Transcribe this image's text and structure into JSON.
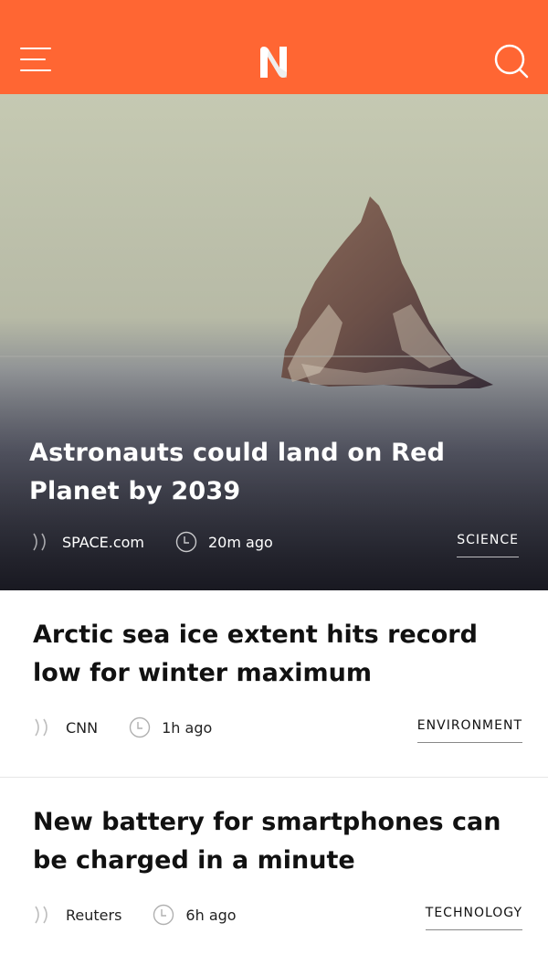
{
  "header": {
    "logo_letter": "N",
    "brand_color": "#ff6633",
    "menu_icon": "hamburger-menu-icon",
    "search_icon": "search-icon"
  },
  "featured": {
    "title": "Astronauts could land on Red Planet by 2039",
    "source": "SPACE.com",
    "time": "20m ago",
    "category": "SCIENCE"
  },
  "articles": [
    {
      "title": "Arctic sea ice extent hits record low for winter maximum",
      "source": "CNN",
      "time": "1h ago",
      "category": "ENVIRONMENT"
    },
    {
      "title": "New battery for smartphones can be charged in a minute",
      "source": "Reuters",
      "time": "6h ago",
      "category": "TECHNOLOGY"
    }
  ]
}
